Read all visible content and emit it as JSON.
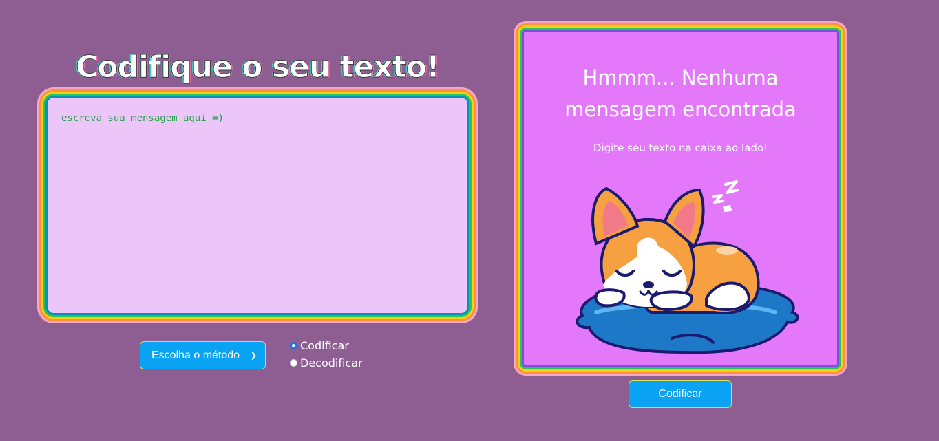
{
  "header": {
    "title": "Codifique o seu texto!"
  },
  "editor": {
    "placeholder": "escreva sua mensagem aqui =)",
    "value": ""
  },
  "controls": {
    "method_select": {
      "selected": "Escolha o método"
    },
    "radio_options": [
      {
        "label": "Codificar",
        "checked": true
      },
      {
        "label": "Decodificar",
        "checked": false
      }
    ]
  },
  "output": {
    "title": "Hmmm... Nenhuma mensagem encontrada",
    "subtitle": "Digite seu texto na caixa ao lado!",
    "illustration": "sleeping-corgi-on-pillow",
    "sleep_text": "zZz"
  },
  "action": {
    "button_label": "Codificar"
  },
  "colors": {
    "background": "#8e5e92",
    "editor_bg": "#ecc6f8",
    "output_bg": "#e379fa",
    "button_bg": "#0aa2f2",
    "placeholder_text": "#22a447"
  }
}
